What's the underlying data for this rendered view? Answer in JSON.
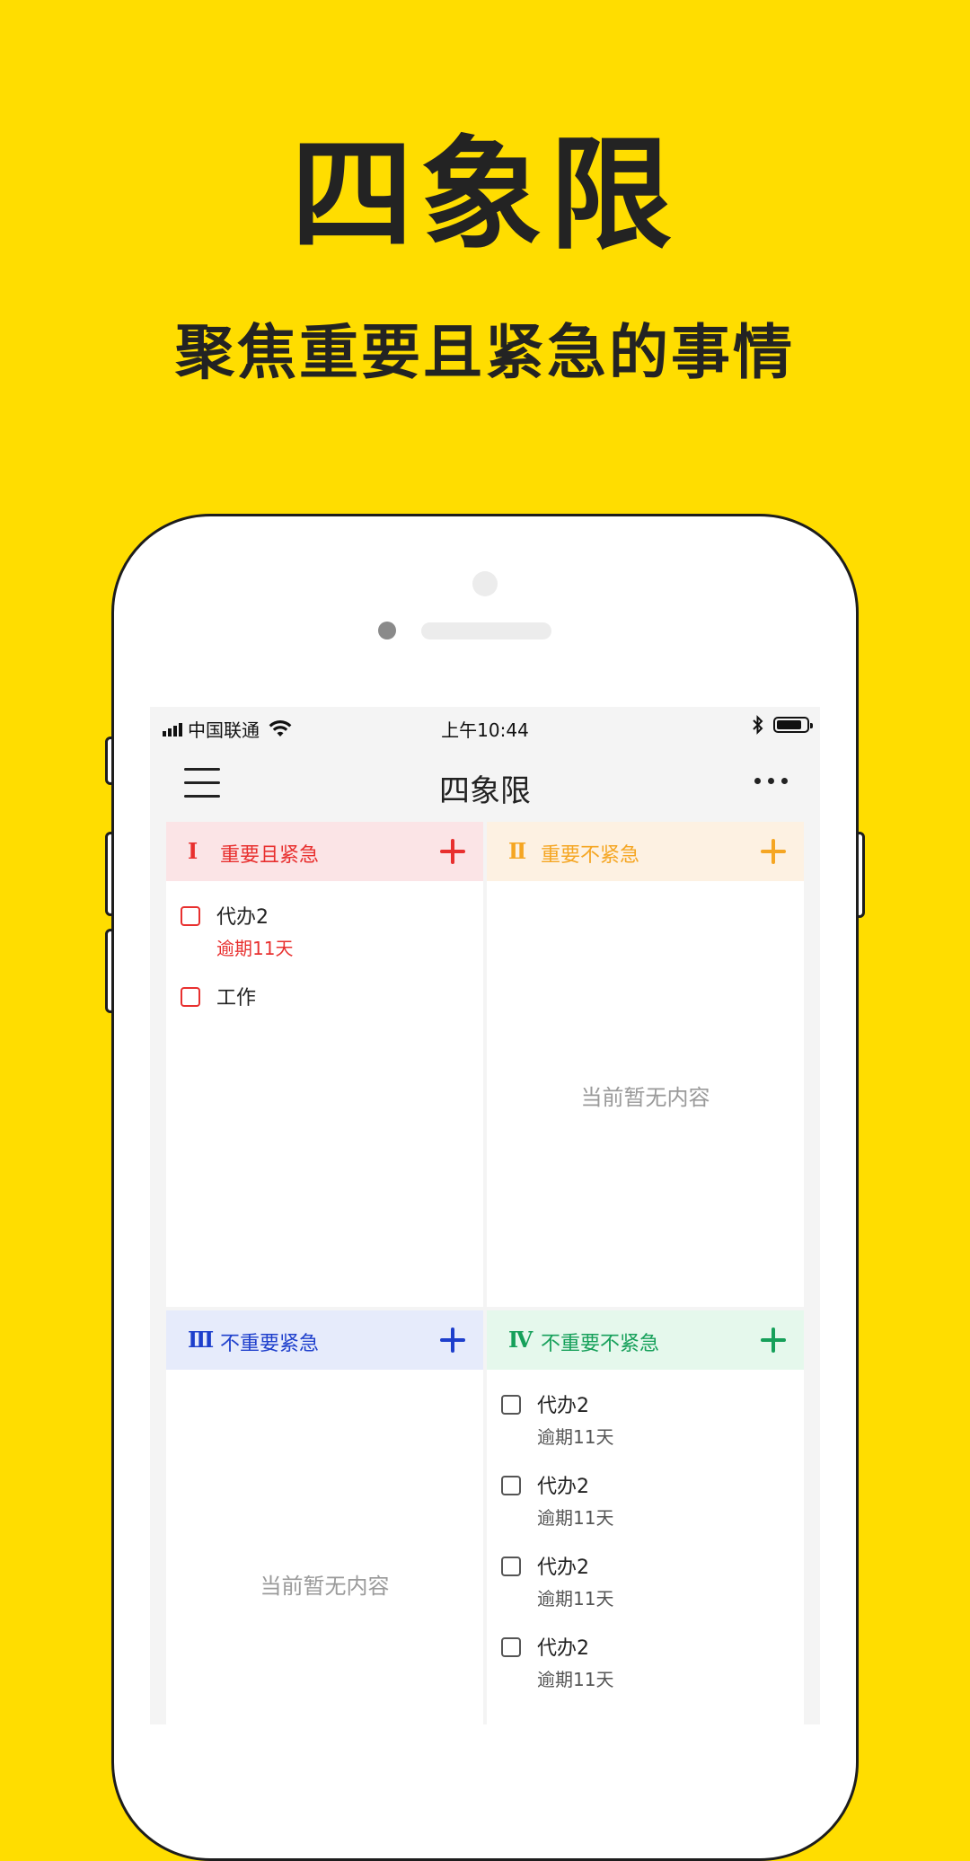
{
  "promo": {
    "title": "四象限",
    "subtitle": "聚焦重要且紧急的事情"
  },
  "status_bar": {
    "carrier": "中国联通",
    "time": "上午10:44",
    "battery_level": 0.85,
    "icons": [
      "signal-icon",
      "wifi-icon",
      "bluetooth-icon",
      "battery-icon"
    ]
  },
  "nav": {
    "title": "四象限",
    "menu_icon": "menu-icon",
    "more_icon": "more-icon"
  },
  "quadrants": [
    {
      "numeral": "Ⅰ",
      "label": "重要且紧急",
      "color": "#E8302F",
      "header_bg": "#FBE4E6",
      "tasks": [
        {
          "title": "代办2",
          "note": "逾期11天"
        },
        {
          "title": "工作"
        }
      ]
    },
    {
      "numeral": "Ⅱ",
      "label": "重要不紧急",
      "color": "#F5A623",
      "header_bg": "#FDF1E2",
      "empty_text": "当前暂无内容"
    },
    {
      "numeral": "Ⅲ",
      "label": "不重要紧急",
      "color": "#1E3FCC",
      "header_bg": "#E6EBFB",
      "empty_text": "当前暂无内容"
    },
    {
      "numeral": "Ⅳ",
      "label": "不重要不紧急",
      "color": "#16A05A",
      "header_bg": "#E5F8EC",
      "tasks": [
        {
          "title": "代办2",
          "note": "逾期11天"
        },
        {
          "title": "代办2",
          "note": "逾期11天"
        },
        {
          "title": "代办2",
          "note": "逾期11天"
        },
        {
          "title": "代办2",
          "note": "逾期11天"
        }
      ]
    }
  ]
}
